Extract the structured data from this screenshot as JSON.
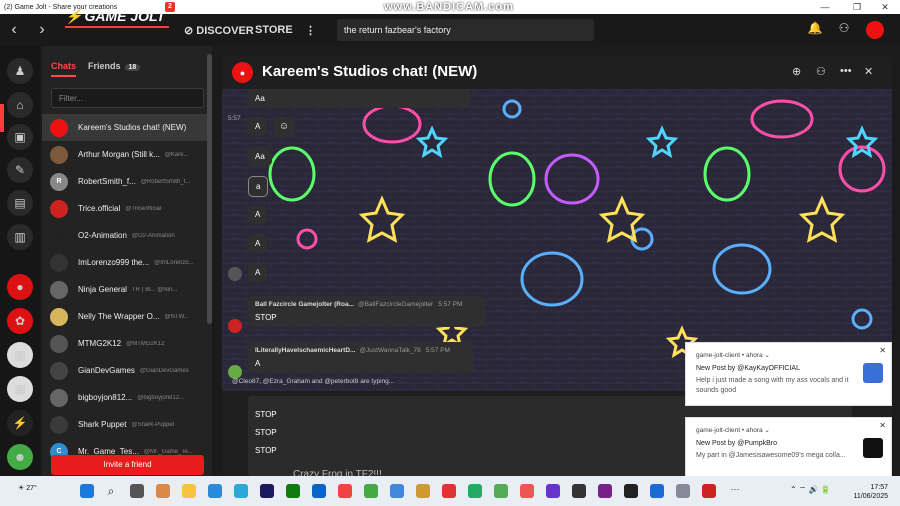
{
  "window": {
    "title": "(2) Game Jolt - Share your creations",
    "recorder": "www.BANDICAM.com",
    "min": "—",
    "restore": "❐",
    "close": "✕"
  },
  "topbar": {
    "back": "‹",
    "forward": "›",
    "logo": "GAME JOLT",
    "logo_badge": "2",
    "discover": "DISCOVER",
    "store": "STORE",
    "more": "⋮",
    "search_value": "the return fazbear's factory"
  },
  "chats_panel": {
    "tab_chats": "Chats",
    "tab_friends": "Friends",
    "friends_count": "18",
    "filter_placeholder": "Filter...",
    "items": [
      {
        "name": "Kareem's Studios chat! (NEW)",
        "handle": "",
        "color": "#e11",
        "initial": ""
      },
      {
        "name": "Arthur Morgan (Still k...",
        "handle": "@Kare...",
        "color": "#7a5a3a",
        "initial": ""
      },
      {
        "name": "RobertSmith_f...",
        "handle": "@RobertSmith_f...",
        "color": "#888",
        "initial": "R"
      },
      {
        "name": "Trice.official",
        "handle": "@Triceofficial",
        "color": "#c22",
        "initial": ""
      },
      {
        "name": "O2-Animation",
        "handle": "@O2-Animation",
        "color": "#222",
        "initial": ""
      },
      {
        "name": "ImLorenzo999 the...",
        "handle": "@ImLorenzo...",
        "color": "#333",
        "initial": ""
      },
      {
        "name": "Ninja General",
        "handle": "TR ( Bl... @Nin...",
        "color": "#666",
        "initial": ""
      },
      {
        "name": "Nelly The Wrapper O...",
        "handle": "@NTW...",
        "color": "#d8b55a",
        "initial": ""
      },
      {
        "name": "MTMG2K12",
        "handle": "@MTMG2K12",
        "color": "#555",
        "initial": ""
      },
      {
        "name": "GianDevGames",
        "handle": "@GianDevGames",
        "color": "#444",
        "initial": ""
      },
      {
        "name": "bigboyjon812...",
        "handle": "@bigboyjon812...",
        "color": "#666",
        "initial": ""
      },
      {
        "name": "Shark Puppet",
        "handle": "@Shark-Puppet",
        "color": "#3a3a3a",
        "initial": ""
      },
      {
        "name": "Mr._Game_Tes...",
        "handle": "@Mr._Game_Te...",
        "color": "#2a8fd0",
        "initial": "C"
      }
    ],
    "invite": "Invite a friend"
  },
  "chat": {
    "title": "Kareem's Studios chat! (NEW)",
    "time_left": "5:57",
    "messages": [
      {
        "text": "Aa"
      },
      {
        "text": "A"
      },
      {
        "text": "Aa"
      },
      {
        "text": "a"
      },
      {
        "text": "A"
      },
      {
        "text": "A"
      },
      {
        "text": "A"
      }
    ],
    "msg_stop": {
      "sender": "Ball Fazcircle Gamejolter (Roa...",
      "handle": "@BallFazcircleGamejolter",
      "time": "5:57 PM",
      "text": "STOP"
    },
    "msg_a": {
      "sender": "ILiterallyHavelschaemicHeartD...",
      "handle": "@JustWannaTalk_78",
      "time": "5:57 PM",
      "text": "A"
    },
    "typing": "@Cleo87, @Ezra_Graham and @peterbot8 are typing...",
    "compose_lines": [
      "STOP",
      "STOP",
      "STOP"
    ]
  },
  "behind_text": "Crazy Frog in TF2!!!",
  "toasts": [
    {
      "source": "game-jolt-client • ahora ⌄",
      "title": "New Post by @KayKayOFFICIAL",
      "body": "Help i just made a song with my ass vocals and it sounds good"
    },
    {
      "source": "game-jolt-client • ahora ⌄",
      "title": "New Post by @PumpkBro",
      "body": "My part in @Jamesisawesome09's mega colla..."
    }
  ],
  "taskbar": {
    "weather": "27°",
    "time": "17:57",
    "date": "11/06/2025",
    "tray": "⌃  ⌔  🔊  🔋"
  },
  "colors": {
    "accent": "#ff3c3c",
    "panel": "#232323"
  }
}
